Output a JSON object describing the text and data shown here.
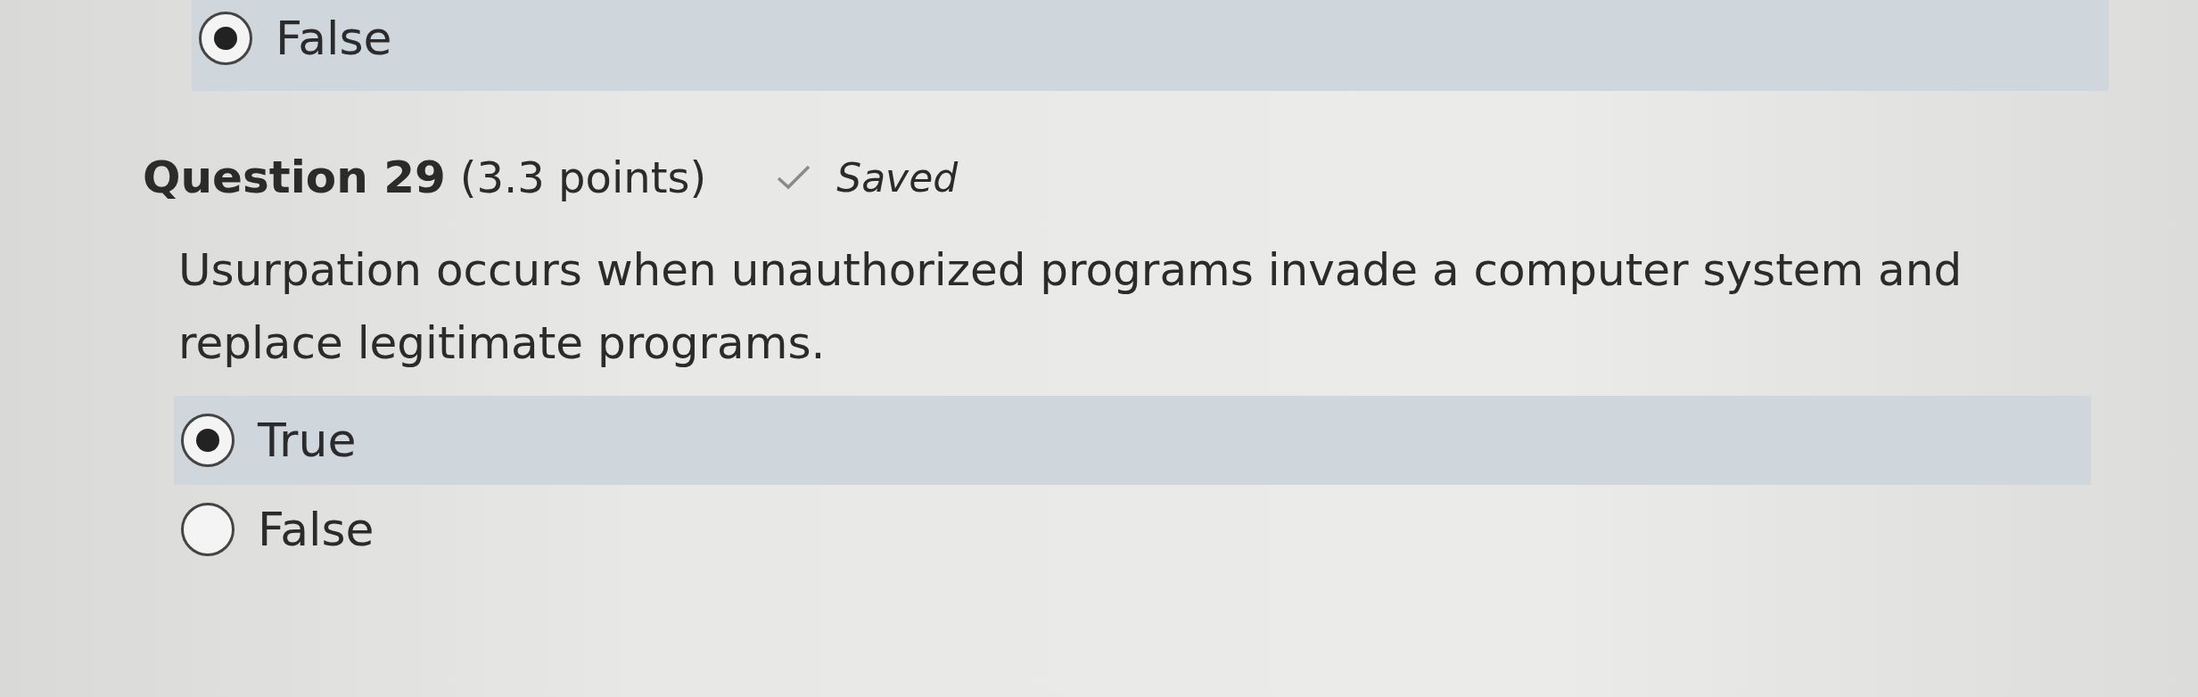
{
  "previous_question": {
    "options": [
      {
        "label": "False",
        "selected": true
      }
    ]
  },
  "question": {
    "title": "Question 29",
    "points": "(3.3 points)",
    "status": "Saved",
    "text": "Usurpation occurs when unauthorized programs invade a computer system and replace legitimate programs.",
    "options": [
      {
        "label": "True",
        "selected": true
      },
      {
        "label": "False",
        "selected": false
      }
    ]
  }
}
